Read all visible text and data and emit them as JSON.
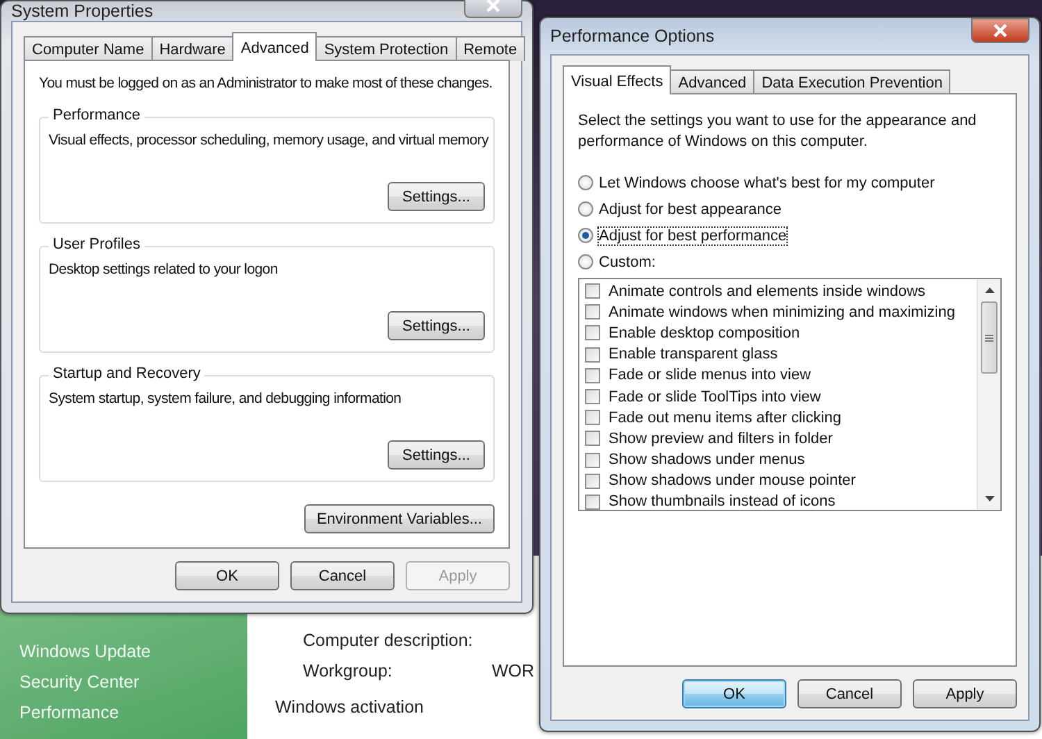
{
  "control_panel": {
    "sidebar_links": [
      "Windows Update",
      "Security Center",
      "Performance"
    ],
    "fields": [
      {
        "label": "Computer description:"
      },
      {
        "label": "Workgroup:",
        "value": "WOR"
      }
    ],
    "section_title": "Windows activation"
  },
  "system_properties": {
    "title": "System Properties",
    "active": false,
    "tabs": [
      {
        "label": "Computer Name",
        "selected": false
      },
      {
        "label": "Hardware",
        "selected": false
      },
      {
        "label": "Advanced",
        "selected": true
      },
      {
        "label": "System Protection",
        "selected": false
      },
      {
        "label": "Remote",
        "selected": false
      }
    ],
    "notice": "You must be logged on as an Administrator to make most of these changes.",
    "groups": [
      {
        "title": "Performance",
        "description": "Visual effects, processor scheduling, memory usage, and virtual memory",
        "button": "Settings..."
      },
      {
        "title": "User Profiles",
        "description": "Desktop settings related to your logon",
        "button": "Settings..."
      },
      {
        "title": "Startup and Recovery",
        "description": "System startup, system failure, and debugging information",
        "button": "Settings..."
      }
    ],
    "extra_button": "Environment Variables...",
    "buttons": [
      {
        "label": "OK",
        "default": false,
        "disabled": false
      },
      {
        "label": "Cancel",
        "default": false,
        "disabled": false
      },
      {
        "label": "Apply",
        "default": false,
        "disabled": true
      }
    ]
  },
  "performance_options": {
    "title": "Performance Options",
    "active": true,
    "tabs": [
      {
        "label": "Visual Effects",
        "selected": true
      },
      {
        "label": "Advanced",
        "selected": false
      },
      {
        "label": "Data Execution Prevention",
        "selected": false
      }
    ],
    "intro": "Select the settings you want to use for the appearance and performance of Windows on this computer.",
    "radios": [
      {
        "label": "Let Windows choose what's best for my computer",
        "selected": false
      },
      {
        "label": "Adjust for best appearance",
        "selected": false
      },
      {
        "label": "Adjust for best performance",
        "selected": true
      },
      {
        "label": "Custom:",
        "selected": false
      }
    ],
    "effects": [
      {
        "label": "Animate controls and elements inside windows",
        "checked": false
      },
      {
        "label": "Animate windows when minimizing and maximizing",
        "checked": false
      },
      {
        "label": "Enable desktop composition",
        "checked": false
      },
      {
        "label": "Enable transparent glass",
        "checked": false
      },
      {
        "label": "Fade or slide menus into view",
        "checked": false
      },
      {
        "label": "Fade or slide ToolTips into view",
        "checked": false
      },
      {
        "label": "Fade out menu items after clicking",
        "checked": false
      },
      {
        "label": "Show preview and filters in folder",
        "checked": false
      },
      {
        "label": "Show shadows under menus",
        "checked": false
      },
      {
        "label": "Show shadows under mouse pointer",
        "checked": false
      },
      {
        "label": "Show thumbnails instead of icons",
        "checked": false
      }
    ],
    "buttons": [
      {
        "label": "OK",
        "default": true,
        "disabled": false
      },
      {
        "label": "Cancel",
        "default": false,
        "disabled": false
      },
      {
        "label": "Apply",
        "default": false,
        "disabled": false
      }
    ]
  }
}
